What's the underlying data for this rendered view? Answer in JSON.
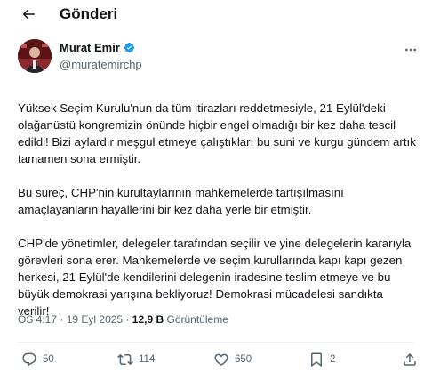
{
  "header": {
    "title": "Gönderi",
    "back_icon": "arrow-left-icon"
  },
  "author": {
    "name": "Murat Emir",
    "handle": "@muratemirchp",
    "verified": true,
    "verified_color": "#1d9bf0"
  },
  "tweet": {
    "paragraphs": [
      "Yüksek Seçim Kurulu'nun da tüm itirazları reddetmesiyle, 21 Eylül'deki olağanüstü kongremizin önünde hiçbir engel olmadığı bir kez daha tescil edildi! Bizi aylardır meşgul etmeye çalıştıkları bu suni ve kurgu gündem artık tamamen sona ermiştir.",
      "Bu süreç, CHP'nin kurultaylarının mahkemelerde tartışılmasını amaçlayanların hayallerini bir kez daha yerle bir etmiştir.",
      "CHP'de yönetimler, delegeler tarafından seçilir ve yine delegelerin kararıyla görevleri sona erer. Mahkemelerde ve seçim kurullarında kapı kapı gezen herkesi, 21 Eylül'de kendilerini delegenin iradesine teslim etmeye ve bu büyük demokrasi yarışına bekliyoruz! Demokrasi mücadelesi sandıkta verilir!"
    ]
  },
  "meta": {
    "time": "ÖS 4:17",
    "separator": "·",
    "date": "19 Eyl 2025",
    "views_count": "12,9 B",
    "views_label": "Görüntüleme"
  },
  "actions": {
    "replies": "50",
    "reposts": "114",
    "likes": "650",
    "bookmarks": "2"
  }
}
